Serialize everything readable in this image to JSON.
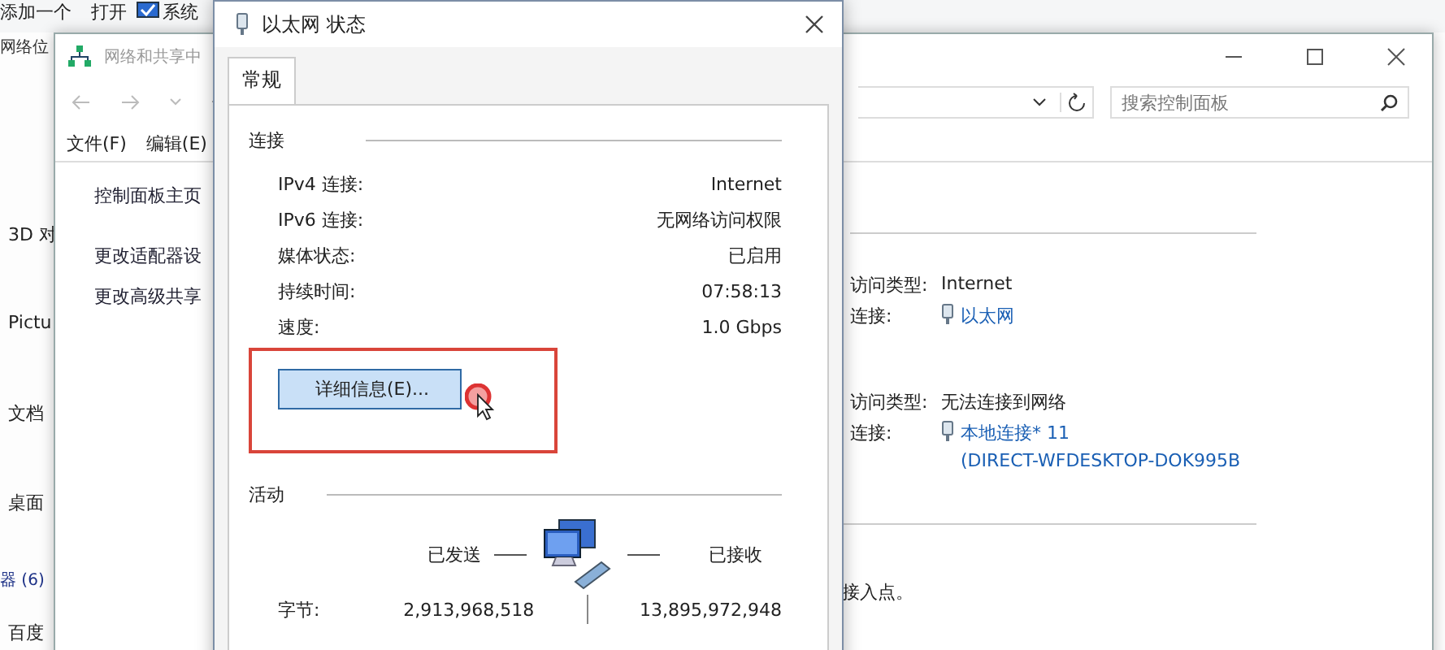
{
  "background_window": {
    "ribbon": [
      "添加一个",
      "打开",
      "系统"
    ],
    "location": "网络位",
    "sidebar": [
      {
        "label": "3D 对",
        "kind": "item"
      },
      {
        "label": "Pictu",
        "kind": "item"
      },
      {
        "label": "文档",
        "kind": "item"
      },
      {
        "label": "桌面",
        "kind": "item"
      },
      {
        "label": "器 (6)",
        "kind": "header"
      },
      {
        "label": "百度",
        "kind": "item"
      }
    ]
  },
  "network_window": {
    "title": "网络和共享中",
    "menu": [
      "文件(F)",
      "编辑(E)"
    ],
    "sidebar_links": [
      "控制面板主页",
      "更改适配器设",
      "更改高级共享"
    ],
    "search": {
      "placeholder": "搜索控制面板"
    },
    "networks": [
      {
        "access_label": "访问类型:",
        "access_value": "Internet",
        "connection_label": "连接:",
        "connection_lines": [
          "以太网"
        ]
      },
      {
        "access_label": "访问类型:",
        "access_value": "无法连接到网络",
        "connection_label": "连接:",
        "connection_lines": [
          "本地连接* 11",
          "(DIRECT-WFDESKTOP-DOK995B"
        ]
      }
    ],
    "footer_text": "接入点。"
  },
  "dialog": {
    "title": "以太网 状态",
    "tabs": [
      {
        "label": "常规",
        "selected": true
      }
    ],
    "connection": {
      "title": "连接",
      "rows": [
        {
          "label": "IPv4 连接:",
          "value": "Internet"
        },
        {
          "label": "IPv6 连接:",
          "value": "无网络访问权限"
        },
        {
          "label": "媒体状态:",
          "value": "已启用"
        },
        {
          "label": "持续时间:",
          "value": "07:58:13"
        },
        {
          "label": "速度:",
          "value": "1.0 Gbps"
        }
      ],
      "details_button": "详细信息(E)...",
      "highlighted": true
    },
    "activity": {
      "title": "活动",
      "sent_label": "已发送",
      "received_label": "已接收",
      "bytes_label": "字节:",
      "bytes_sent": "2,913,968,518",
      "bytes_received": "13,895,972,948"
    }
  }
}
